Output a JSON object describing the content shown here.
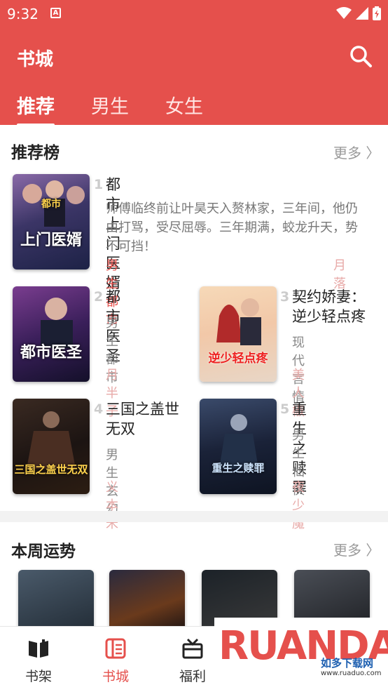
{
  "status": {
    "time": "9:32"
  },
  "header": {
    "title": "书城"
  },
  "tabs": [
    {
      "label": "推荐"
    },
    {
      "label": "男生"
    },
    {
      "label": "女生"
    }
  ],
  "section1": {
    "title": "推荐榜",
    "more": "更多 〉",
    "books": [
      {
        "rank": "1",
        "name": "都市上门医婿",
        "desc": "师傅临终前让叶昊天入赘林家，三年间，他仍由打骂，受尽屈辱。三年期满，蛟龙升天，势不可挡！",
        "category": "男生都市",
        "author": "月落",
        "cover_top": "都市",
        "cover_main": "上门医婿"
      },
      {
        "rank": "2",
        "name": "都市医圣",
        "category": "男生都市",
        "author": "月半子",
        "cover_main": "都市医圣"
      },
      {
        "rank": "3",
        "name": "契约娇妻：逆少轻点疼",
        "category": "现代言情",
        "author": "美人椒",
        "cover_main": "逆少轻点疼"
      },
      {
        "rank": "4",
        "name": "三国之盖世无双",
        "category": "男生玄幻",
        "author": "义本米",
        "cover_main": "三国之盖世无双"
      },
      {
        "rank": "5",
        "name": "重生之赎罪",
        "category": "男生仙侠",
        "author": "夜少魔",
        "cover_main": "重生之赎罪"
      }
    ]
  },
  "section2": {
    "title": "本周运势",
    "more": "更多 〉"
  },
  "nav": [
    {
      "label": "书架"
    },
    {
      "label": "书城"
    },
    {
      "label": "福利"
    }
  ],
  "watermark": {
    "brand": "RUANDAO",
    "sub": "如多下载网",
    "url": "www.ruaduo.com"
  },
  "colors": {
    "accent": "#e5504c",
    "author": "#e8aaa8"
  }
}
